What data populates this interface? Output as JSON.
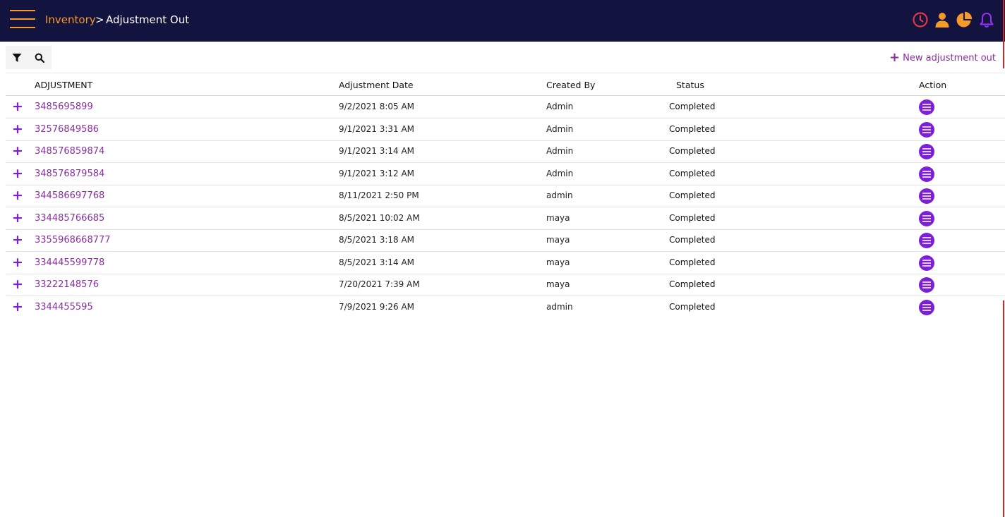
{
  "header": {
    "breadcrumb_root": "Inventory",
    "breadcrumb_separator": ">",
    "page_title": "Adjustment Out",
    "icons": [
      "clock-icon",
      "user-icon",
      "pie-chart-icon",
      "bell-icon"
    ],
    "colors": {
      "bar": "#13133f",
      "accent": "#f39a2b",
      "clock": "#e0384a",
      "bell": "#9b30ff"
    }
  },
  "toolbar": {
    "filter_icon": "filter-icon",
    "search_icon": "search-icon",
    "new_label": "New adjustment out"
  },
  "table": {
    "columns": [
      "ADJUSTMENT",
      "Adjustment Date",
      "Created By",
      "Status",
      "Action"
    ],
    "rows": [
      {
        "adjustment": "3485695899",
        "date": "9/2/2021 8:05 AM",
        "created_by": "Admin",
        "status": "Completed"
      },
      {
        "adjustment": "32576849586",
        "date": "9/1/2021 3:31 AM",
        "created_by": "Admin",
        "status": "Completed"
      },
      {
        "adjustment": "348576859874",
        "date": "9/1/2021 3:14 AM",
        "created_by": "Admin",
        "status": "Completed"
      },
      {
        "adjustment": "348576879584",
        "date": "9/1/2021 3:12 AM",
        "created_by": "Admin",
        "status": "Completed"
      },
      {
        "adjustment": "344586697768",
        "date": "8/11/2021 2:50 PM",
        "created_by": "admin",
        "status": "Completed"
      },
      {
        "adjustment": "334485766685",
        "date": "8/5/2021 10:02 AM",
        "created_by": "maya",
        "status": "Completed"
      },
      {
        "adjustment": "3355968668777",
        "date": "8/5/2021 3:18 AM",
        "created_by": "maya",
        "status": "Completed"
      },
      {
        "adjustment": "334445599778",
        "date": "8/5/2021 3:14 AM",
        "created_by": "maya",
        "status": "Completed"
      },
      {
        "adjustment": "33222148576",
        "date": "7/20/2021 7:39 AM",
        "created_by": "maya",
        "status": "Completed"
      },
      {
        "adjustment": "3344455595",
        "date": "7/9/2021 9:26 AM",
        "created_by": "admin",
        "status": "Completed"
      }
    ]
  }
}
